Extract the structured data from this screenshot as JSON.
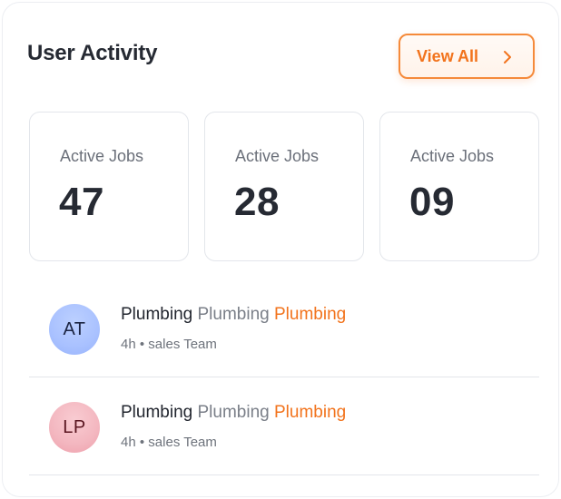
{
  "header": {
    "title": "User Activity",
    "view_all_label": "View All",
    "accent_color": "#f2731c"
  },
  "stats": [
    {
      "label": "Active Jobs",
      "value": "47"
    },
    {
      "label": "Active Jobs",
      "value": "28"
    },
    {
      "label": "Active Jobs",
      "value": "09"
    }
  ],
  "activity": [
    {
      "initials": "AT",
      "avatar_color": "#a9c1ff",
      "words": [
        "Plumbing",
        "Plumbing",
        "Plumbing"
      ],
      "time": "4h",
      "separator": "•",
      "team": "sales Team"
    },
    {
      "initials": "LP",
      "avatar_color": "#f3b6bf",
      "words": [
        "Plumbing",
        "Plumbing",
        "Plumbing"
      ],
      "time": "4h",
      "separator": "•",
      "team": "sales Team"
    }
  ],
  "icons": {
    "view_all": "chevron-right-icon"
  }
}
